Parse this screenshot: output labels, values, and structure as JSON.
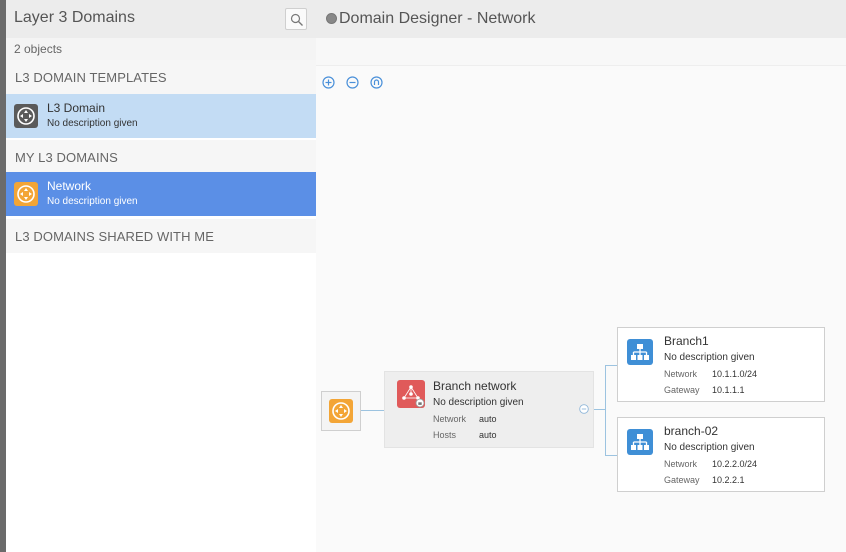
{
  "sidebar": {
    "title": "Layer 3 Domains",
    "count": "2 objects",
    "sections": [
      {
        "label": "L3 DOMAIN TEMPLATES",
        "items": [
          {
            "title": "L3 Domain",
            "description": "No description given",
            "icon": "router-icon",
            "icon_color": "#5a5a5a"
          }
        ]
      },
      {
        "label": "MY L3 DOMAINS",
        "items": [
          {
            "title": "Network",
            "description": "No description given",
            "icon": "router-icon",
            "icon_color": "#f3a536"
          }
        ]
      },
      {
        "label": "L3 DOMAINS SHARED WITH ME",
        "items": []
      }
    ]
  },
  "designer": {
    "title": "Domain Designer - Network",
    "zoom_controls": [
      "zoom-in",
      "zoom-out",
      "reset-zoom"
    ],
    "zone": {
      "title": "Branch network",
      "description": "No description given",
      "fields": [
        {
          "key": "Network",
          "value": "auto"
        },
        {
          "key": "Hosts",
          "value": "auto"
        }
      ]
    },
    "subnets": [
      {
        "title": "Branch1",
        "description": "No description given",
        "fields": [
          {
            "key": "Network",
            "value": "10.1.1.0/24"
          },
          {
            "key": "Gateway",
            "value": "10.1.1.1"
          }
        ]
      },
      {
        "title": "branch-02",
        "description": "No description given",
        "fields": [
          {
            "key": "Network",
            "value": "10.2.2.0/24"
          },
          {
            "key": "Gateway",
            "value": "10.2.2.1"
          }
        ]
      }
    ]
  },
  "colors": {
    "selected_template": "#c3dcf4",
    "selected_domain": "#5b8fe6",
    "router_orange": "#f3a536",
    "zone_red": "#e05a5a",
    "subnet_blue": "#3f8fd6",
    "accent": "#4a90d9"
  }
}
